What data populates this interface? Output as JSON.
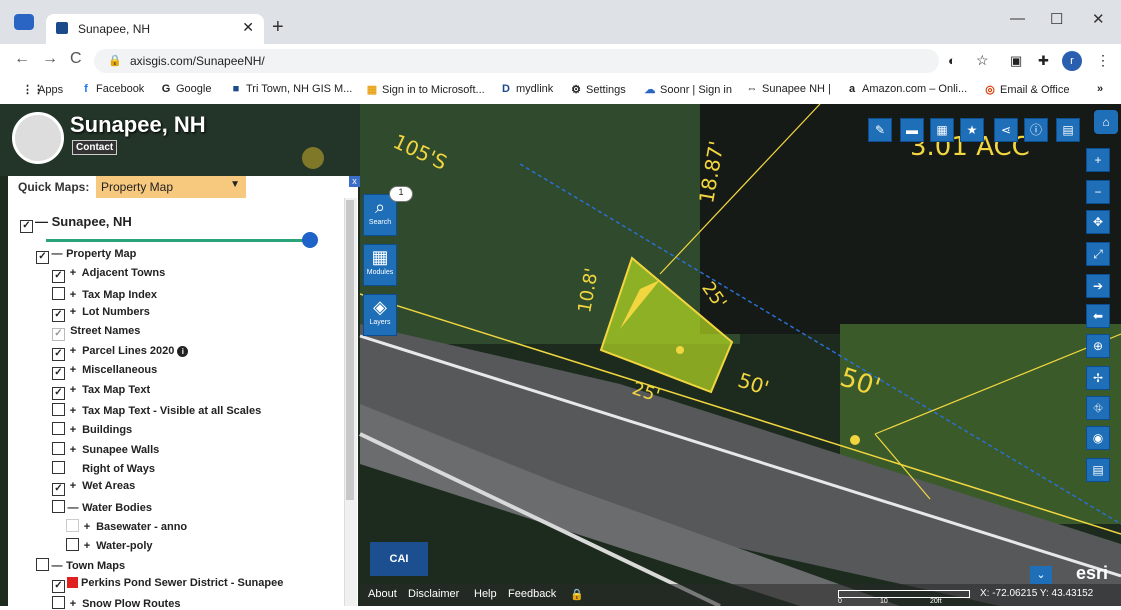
{
  "browser": {
    "tab_title": "Sunapee, NH",
    "tab_close": "✕",
    "new_tab": "+",
    "url": "axisgis.com/SunapeeNH/",
    "window_controls": {
      "minimize": "—",
      "maximize": "☐",
      "close": "✕"
    },
    "nav": {
      "back": "←",
      "forward": "→",
      "reload": "C"
    },
    "profile_initial": "r"
  },
  "bookmarks": [
    {
      "icon": "⋮⋮",
      "label": "Apps"
    },
    {
      "icon": "f",
      "label": "Facebook"
    },
    {
      "icon": "G",
      "label": "Google"
    },
    {
      "icon": "■",
      "label": "Tri Town, NH GIS M..."
    },
    {
      "icon": "▦",
      "label": "Sign in to Microsoft..."
    },
    {
      "icon": "D",
      "label": "mydlink"
    },
    {
      "icon": "⚙",
      "label": "Settings"
    },
    {
      "icon": "☁",
      "label": "Soonr | Sign in"
    },
    {
      "icon": "⇔",
      "label": "Sunapee NH |"
    },
    {
      "icon": "a",
      "label": "Amazon.com – Onli..."
    },
    {
      "icon": "◎",
      "label": "Email & Office"
    },
    {
      "icon": "»",
      "label": ""
    }
  ],
  "app": {
    "title": "Sunapee, NH",
    "contact": "Contact",
    "quick_maps_label": "Quick Maps:",
    "quick_maps_value": "Property Map",
    "panel_close": "x"
  },
  "layers": {
    "root": {
      "label": "Sunapee, NH",
      "checked": "✓"
    },
    "items": [
      {
        "label": "Property Map",
        "checked": "✓",
        "pm": "—"
      },
      {
        "label": "Adjacent Towns",
        "checked": "✓",
        "pm": "+"
      },
      {
        "label": "Tax Map Index",
        "checked": "",
        "pm": "+"
      },
      {
        "label": "Lot Numbers",
        "checked": "✓",
        "pm": "+"
      },
      {
        "label": "Street Names",
        "checked": "✓",
        "pm": ""
      },
      {
        "label": "Parcel Lines 2020",
        "checked": "✓",
        "pm": "+",
        "info": "i"
      },
      {
        "label": "Miscellaneous",
        "checked": "✓",
        "pm": "+"
      },
      {
        "label": "Tax Map Text",
        "checked": "✓",
        "pm": "+"
      },
      {
        "label": "Tax Map Text - Visible at all Scales",
        "checked": "",
        "pm": "+"
      },
      {
        "label": "Buildings",
        "checked": "",
        "pm": "+"
      },
      {
        "label": "Sunapee Walls",
        "checked": "",
        "pm": "+"
      },
      {
        "label": "Right of Ways",
        "checked": "",
        "pm": ""
      },
      {
        "label": "Wet Areas",
        "checked": "✓",
        "pm": "+"
      },
      {
        "label": "Water Bodies",
        "checked": "",
        "pm": "—"
      },
      {
        "label": "Basewater - anno",
        "checked": "",
        "pm": "+"
      },
      {
        "label": "Water-poly",
        "checked": "",
        "pm": "+"
      },
      {
        "label": "Town Maps",
        "checked": "",
        "pm": "—"
      },
      {
        "label": "Perkins Pond Sewer District - Sunapee",
        "checked": "✓",
        "pm": ""
      },
      {
        "label": "Snow Plow Routes",
        "checked": "",
        "pm": "+"
      }
    ]
  },
  "left_tools": [
    {
      "icon": "⌕",
      "label": "Search"
    },
    {
      "icon": "▦",
      "label": "Modules"
    },
    {
      "icon": "◈",
      "label": "Layers"
    }
  ],
  "badge": "1",
  "map_labels": {
    "street": "105'S",
    "d1": "18.87'",
    "d2": "10.8'",
    "d3": "25'",
    "d4": "25'",
    "d5": "50'",
    "d6": "50'",
    "acreage": "3.01 ACC"
  },
  "bottom": {
    "links": [
      "About",
      "Disclaimer",
      "Help",
      "Feedback"
    ],
    "coords": "X: -72.06215  Y: 43.43152",
    "esri": "esri",
    "cai": "CAI",
    "scale_ticks": [
      "0",
      "10",
      "20ft"
    ]
  },
  "colors": {
    "tool_blue": "#1f6fb8",
    "parcel_yellow": "#f2d640",
    "quick_map_orange": "#f7c97e",
    "slider_green": "#2aa57a"
  }
}
